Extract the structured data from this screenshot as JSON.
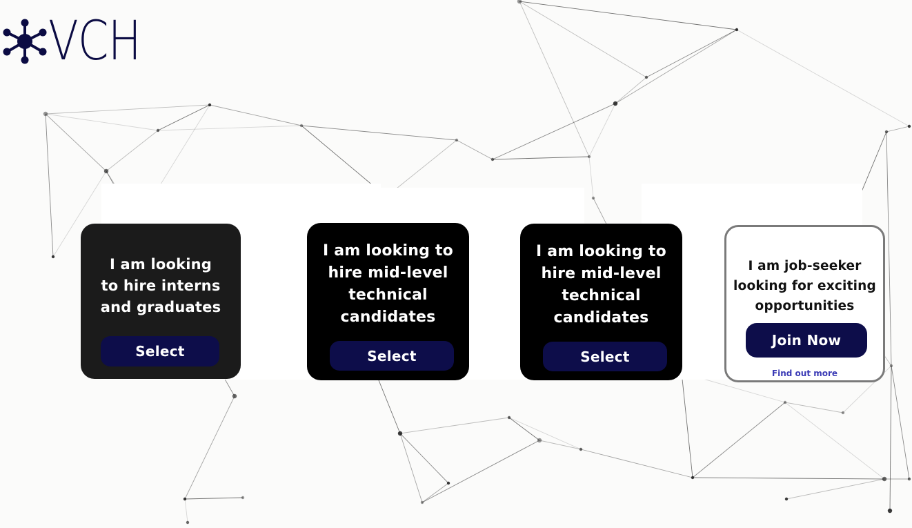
{
  "brand": {
    "logo_text": "VCH",
    "color": "#0b0b43"
  },
  "cards": [
    {
      "title_lines": [
        "I am looking",
        "to hire interns",
        "and graduates"
      ],
      "button_label": "Select"
    },
    {
      "title_lines": [
        "I am looking to",
        "hire mid-level",
        "technical",
        "candidates"
      ],
      "button_label": "Select"
    },
    {
      "title_lines": [
        "I am looking to",
        "hire mid-level",
        "technical",
        "candidates"
      ],
      "button_label": "Select"
    },
    {
      "title_lines": [
        "I am job-seeker",
        "looking for exciting",
        "opportunities"
      ],
      "button_label": "Join Now",
      "link_label": "Find out more"
    }
  ],
  "colors": {
    "button": "#0d0d4a",
    "link": "#3a3ab5",
    "page_background": "#fbfbfa"
  }
}
